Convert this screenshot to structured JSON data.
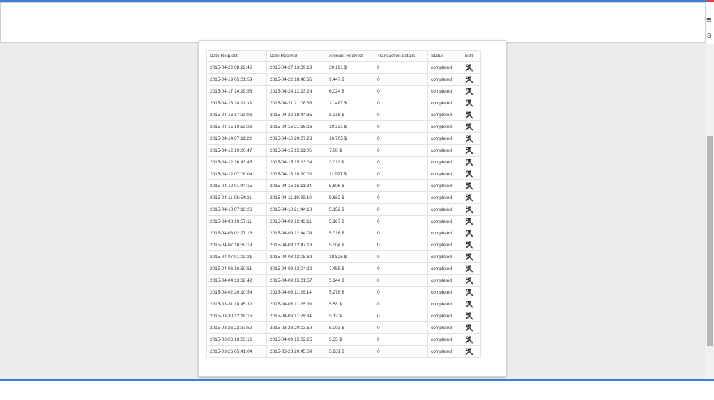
{
  "table": {
    "columns": [
      "Date Request",
      "Date Recived",
      "Amount Recived",
      "Transaction details",
      "Status",
      "Edit"
    ],
    "rows": [
      [
        "2015-04-22 08:22:42",
        "2015-04-27 13:39:19",
        "30.191 $",
        "0",
        "completed"
      ],
      [
        "2015-04-19 05:01:53",
        "2015-04-22 18:46:35",
        "9.447 $",
        "0",
        "completed"
      ],
      [
        "2015-04-17 14:29:53",
        "2015-04-24 12:23:24",
        "6.024 $",
        "0",
        "completed"
      ],
      [
        "2015-04-16 20:11:33",
        "2015-04-21 21:06:36",
        "21.487 $",
        "0",
        "completed"
      ],
      [
        "2015-04-16 17:23:03",
        "2015-04-22 18:44:35",
        "8.216 $",
        "0",
        "completed"
      ],
      [
        "2015-04-15 10:53:28",
        "2015-04-16 21:16:26",
        "10.331 $",
        "0",
        "completed"
      ],
      [
        "2015-04-14 07:11:29",
        "2015-04-16 20:07:23",
        "16.705 $",
        "0",
        "completed"
      ],
      [
        "2015-04-12 19:00:47",
        "2015-04-15 15:11:05",
        "7.08 $",
        "0",
        "completed"
      ],
      [
        "2015-04-12 16:43:45",
        "2015-04-15 15:13:04",
        "3.011 $",
        "0",
        "completed"
      ],
      [
        "2015-04-12 07:08:04",
        "2015-04-13 18:20:00",
        "11.997 $",
        "0",
        "completed"
      ],
      [
        "2015-04-12 01:44:15",
        "2015-04-15 15:11:34",
        "5.606 $",
        "0",
        "completed"
      ],
      [
        "2015-04-11 06:54:31",
        "2015-04-11 19:39:10",
        "5.682 $",
        "0",
        "completed"
      ],
      [
        "2015-04-10 07:16:26",
        "2015-04-10 21:44:18",
        "5.152 $",
        "0",
        "completed"
      ],
      [
        "2015-04-08 10:57:11",
        "2015-04-09 12:43:11",
        "5.167 $",
        "0",
        "completed"
      ],
      [
        "2015-04-08 02:27:16",
        "2015-04-09 12:44:09",
        "5.016 $",
        "0",
        "completed"
      ],
      [
        "2015-04-07 16:59:19",
        "2015-04-09 12:47:13",
        "5.004 $",
        "0",
        "completed"
      ],
      [
        "2015-04-07 01:09:21",
        "2015-04-08 12:05:39",
        "18.825 $",
        "0",
        "completed"
      ],
      [
        "2015-04-06 16:50:51",
        "2015-04-08 12:04:22",
        "7.455 $",
        "0",
        "completed"
      ],
      [
        "2015-04-04 13:38:42",
        "2015-04-09 15:01:57",
        "5.144 $",
        "0",
        "completed"
      ],
      [
        "2015-04-02 20:10:54",
        "2015-04-06 11:26:14",
        "5.276 $",
        "0",
        "completed"
      ],
      [
        "2015-03-31 18:45:30",
        "2015-04-06 11:26:09",
        "5.58 $",
        "0",
        "completed"
      ],
      [
        "2015-03-30 12:18:16",
        "2015-04-06 11:28:34",
        "5.12 $",
        "0",
        "completed"
      ],
      [
        "2015-03-26 22:37:52",
        "2015-03-28 20:03:59",
        "5.003 $",
        "0",
        "completed"
      ],
      [
        "2015-03-26 10:03:12",
        "2015-04-09 15:02:25",
        "5.35 $",
        "0",
        "completed"
      ],
      [
        "2015-03-26 05:41:04",
        "2015-03-28 20:45:09",
        "5.931 $",
        "0",
        "completed"
      ]
    ],
    "edit_icon": "tools-icon"
  },
  "chrome": {
    "menu_glyph": "≡",
    "side_letter": "s"
  },
  "colors": {
    "accent": "#3b7dd8",
    "window_bg": "#ececec",
    "scroll_thumb": "#b5b5b5"
  }
}
